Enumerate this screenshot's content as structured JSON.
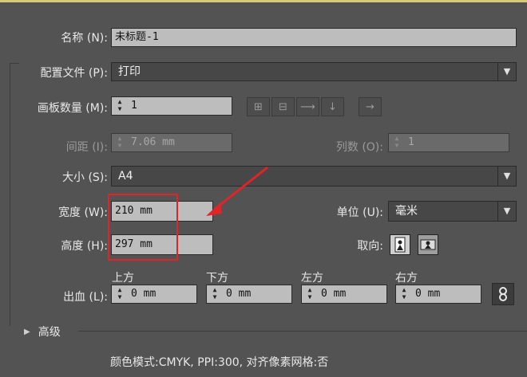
{
  "name_label": "名称 (N):",
  "name_value": "未标题-1",
  "profile_label": "配置文件 (P):",
  "profile_value": "打印",
  "artboards_label": "画板数量 (M):",
  "artboards_value": "1",
  "spacing_label": "间距 (I):",
  "spacing_value": "7.06 mm",
  "columns_label": "列数 (O):",
  "columns_value": "1",
  "size_label": "大小 (S):",
  "size_value": "A4",
  "width_label": "宽度 (W):",
  "width_value": "210 mm",
  "units_label": "单位 (U):",
  "units_value": "毫米",
  "height_label": "高度 (H):",
  "height_value": "297 mm",
  "orientation_label": "取向:",
  "bleed_label": "出血 (L):",
  "bleed": {
    "top_label": "上方",
    "top_value": "0 mm",
    "bottom_label": "下方",
    "bottom_value": "0 mm",
    "left_label": "左方",
    "left_value": "0 mm",
    "right_label": "右方",
    "right_value": "0 mm"
  },
  "advanced_label": "高级",
  "summary": "颜色模式:CMYK, PPI:300, 对齐像素网格:否",
  "colors": {
    "highlight": "#e0242a",
    "accent_bar": "#d9c877"
  }
}
